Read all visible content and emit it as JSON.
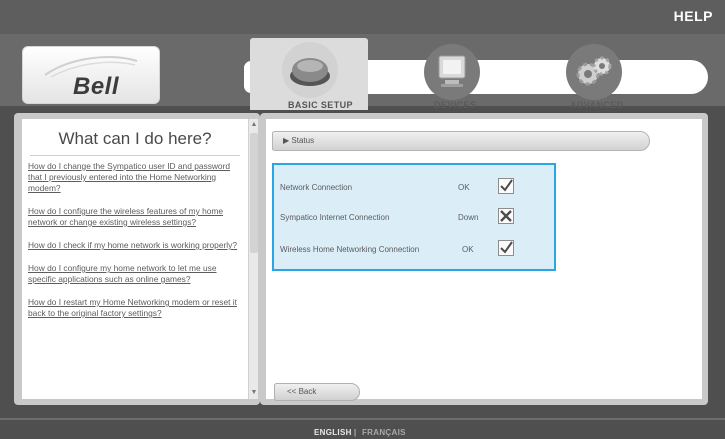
{
  "header": {
    "help_label": "HELP",
    "brand": "Bell"
  },
  "nav": {
    "tabs": [
      {
        "label": "BASIC SETUP",
        "icon": "modem-icon",
        "active": true
      },
      {
        "label": "DEVICES",
        "icon": "monitor-icon",
        "active": false
      },
      {
        "label": "ADVANCED",
        "icon": "gears-icon",
        "active": false
      }
    ]
  },
  "help_panel": {
    "title": "What can I do here?",
    "links": [
      "How do I change the Sympatico user ID and password that I previously entered into the Home Networking modem?",
      "How do I configure the wireless features of my home network or change existing wireless settings?",
      "How do I check if my home network is working properly?",
      "How do I configure my home network to let me use specific applications such as online games?",
      "How do I restart my Home Networking modem or reset it back to the original factory settings?"
    ]
  },
  "status_panel": {
    "section_title": "Status",
    "rows": [
      {
        "name": "Network Connection",
        "value": "OK",
        "icon": "checkmark-icon"
      },
      {
        "name": "Sympatico Internet Connection",
        "value": "Down",
        "icon": "x-mark-icon"
      },
      {
        "name": "Wireless Home Networking Connection",
        "value": "OK",
        "icon": "checkmark-icon"
      }
    ],
    "back_label": "<< Back"
  },
  "footer": {
    "english": "ENGLISH",
    "separator": "|",
    "francais": "FRANÇAIS"
  },
  "colors": {
    "background": "#4f4f4f",
    "highlight_border": "#2aa6e6",
    "highlight_fill": "#dbeef8"
  }
}
